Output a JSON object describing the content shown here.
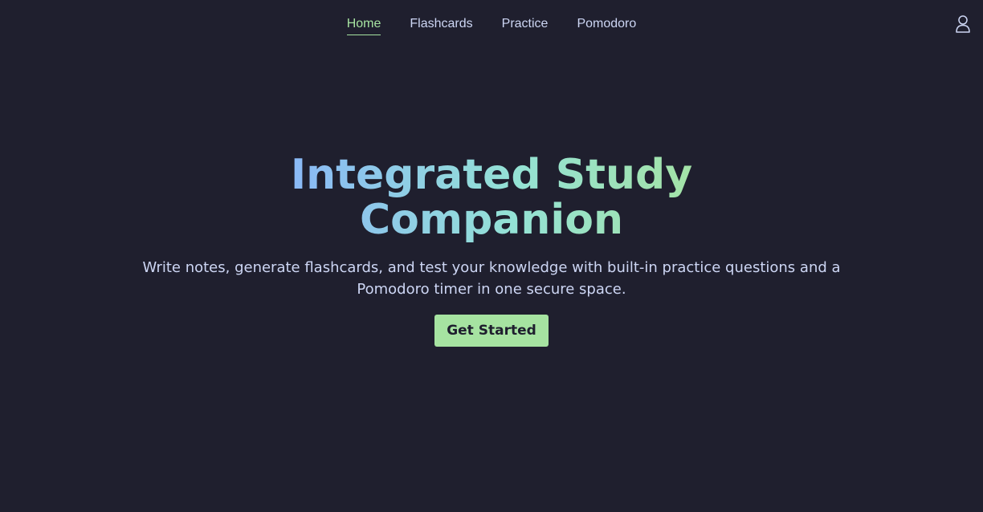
{
  "nav": {
    "links": [
      {
        "label": "Home",
        "active": true
      },
      {
        "label": "Flashcards",
        "active": false
      },
      {
        "label": "Practice",
        "active": false
      },
      {
        "label": "Pomodoro",
        "active": false
      }
    ],
    "account_icon": "user-icon"
  },
  "hero": {
    "title": "Integrated Study Companion",
    "subtitle": "Write notes, generate flashcards, and test your knowledge with built-in practice questions and a Pomodoro timer in one secure space.",
    "cta_label": "Get Started"
  },
  "colors": {
    "background": "#1f1f2e",
    "accent": "#a6e3a1",
    "gradient_start": "#89b4fa",
    "gradient_end": "#a6e3a1",
    "text": "#cdd6f4"
  }
}
